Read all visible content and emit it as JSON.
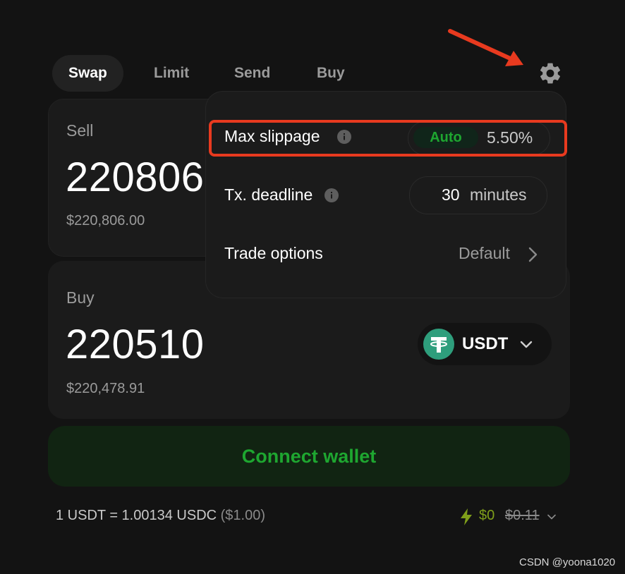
{
  "tabs": [
    {
      "label": "Swap",
      "active": true
    },
    {
      "label": "Limit",
      "active": false
    },
    {
      "label": "Send",
      "active": false
    },
    {
      "label": "Buy",
      "active": false
    }
  ],
  "sell": {
    "label": "Sell",
    "amount": "220806",
    "usd_value": "$220,806.00"
  },
  "buy": {
    "label": "Buy",
    "amount": "220510",
    "usd_value": "$220,478.91",
    "token": {
      "symbol": "USDT",
      "icon": "tether-logo-icon",
      "color": "#2e9e7c"
    }
  },
  "connect_button": {
    "label": "Connect wallet",
    "color": "#1ea630"
  },
  "rate": {
    "text": "1 USDT = 1.00134 USDC",
    "usd": "($1.00)"
  },
  "fee": {
    "current": "$0",
    "original": "$0.11",
    "icon": "lightning-bolt-icon",
    "color": "#7f9f1a"
  },
  "settings": {
    "icon": "gear-icon",
    "max_slippage": {
      "label": "Max slippage",
      "auto_label": "Auto",
      "value": "5.50%"
    },
    "tx_deadline": {
      "label": "Tx. deadline",
      "value": "30",
      "unit": "minutes"
    },
    "trade_options": {
      "label": "Trade options",
      "value": "Default"
    }
  },
  "annotation": {
    "highlight_color": "#e83a1f"
  },
  "watermark": "CSDN @yoona1020"
}
